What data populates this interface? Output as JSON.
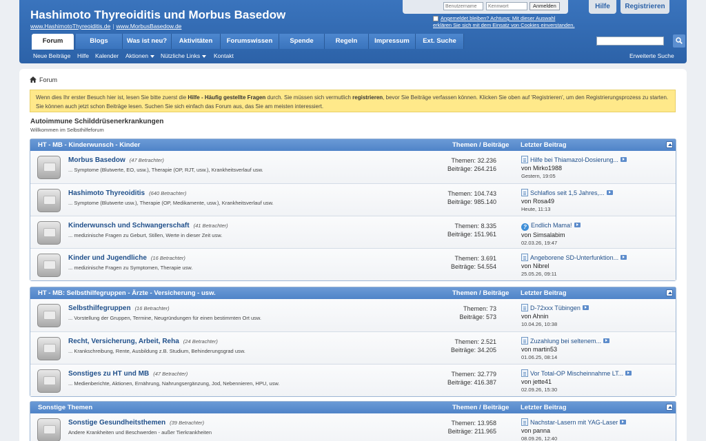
{
  "header": {
    "title": "Hashimoto Thyreoiditis und Morbus Basedow",
    "link1": "www.HashimotoThyreoiditis.de",
    "link2": "www.MorbusBasedow.de",
    "separator": "|"
  },
  "login": {
    "username_placeholder": "Benutzername",
    "password_placeholder": "Kennwort",
    "submit_label": "Anmelden",
    "remember_line1": "Angemeldet bleiben? Achtung: Mit dieser Auswahl",
    "remember_line2": "erklären Sie sich mit dem Einsatz von Cookies einverstanden."
  },
  "top_buttons": {
    "help": "Hilfe",
    "register": "Registrieren"
  },
  "nav": {
    "tabs": [
      "Forum",
      "Blogs",
      "Was ist neu?",
      "Aktivitäten",
      "Forumswissen",
      "Spende",
      "Regeln",
      "Impressum",
      "Ext. Suche"
    ],
    "search_placeholder": ""
  },
  "subnav": {
    "items": [
      "Neue Beiträge",
      "Hilfe",
      "Kalender",
      "Aktionen",
      "Nützliche Links",
      "Kontakt"
    ],
    "advanced_search": "Erweiterte Suche"
  },
  "breadcrumb": {
    "label": "Forum"
  },
  "notice": {
    "t1": "Wenn dies Ihr erster Besuch hier ist, lesen Sie bitte zuerst die ",
    "b1": "Hilfe - Häufig gestellte Fragen",
    "t2": " durch. Sie müssen sich vermutlich ",
    "b2": "registrieren",
    "t3": ", bevor Sie Beiträge verfassen können. Klicken Sie oben auf 'Registrieren', um den Registrierungsprozess zu starten. Sie können auch jetzt schon Beiträge lesen. Suchen Sie sich einfach das Forum aus, das Sie am meisten interessiert."
  },
  "category": {
    "title": "Autoimmune Schilddrüsenerkrankungen",
    "subtitle": "Willkommen im Selbsthilfeforum"
  },
  "col_stats": "Themen / Beiträge",
  "col_last": "Letzter Beitrag",
  "sections": [
    {
      "title": "HT - MB - Kinderwunsch - Kinder",
      "forums": [
        {
          "name": "Morbus Basedow",
          "viewers": "(47 Betrachter)",
          "desc": "... Symptome (Blutwerte, EO, usw.), Therapie (OP, RJT, usw.), Krankheitsverlauf usw.",
          "threads": "Themen: 32.236",
          "posts": "Beiträge: 264.216",
          "last_title": "Hilfe bei Thiamazol-Dosierung...",
          "last_by": "von Mirko1988",
          "last_date": "Gestern, 19:05",
          "icon": "doc"
        },
        {
          "name": "Hashimoto Thyreoiditis",
          "viewers": "(640 Betrachter)",
          "desc": "... Symptome (Blutwerte usw.), Therapie (OP, Medikamente, usw.), Krankheitsverlauf usw.",
          "threads": "Themen: 104.743",
          "posts": "Beiträge: 985.140",
          "last_title": "Schlaflos seit 1,5 Jahres,...",
          "last_by": "von Rosa49",
          "last_date": "Heute, 11:13",
          "icon": "doc"
        },
        {
          "name": "Kinderwunsch und Schwangerschaft",
          "viewers": "(41 Betrachter)",
          "desc": "... medizinische Fragen zu Geburt, Stillen, Werte in dieser Zeit usw.",
          "threads": "Themen: 8.335",
          "posts": "Beiträge: 151.961",
          "last_title": "Endlich Mama!",
          "last_by": "von Simsalabim",
          "last_date": "02.03.26, 19:47",
          "icon": "question"
        },
        {
          "name": "Kinder und Jugendliche",
          "viewers": "(16 Betrachter)",
          "desc": "... medizinische Fragen zu Symptomen, Therapie usw.",
          "threads": "Themen: 3.691",
          "posts": "Beiträge: 54.554",
          "last_title": "Angeborene SD-Unterfunktion...",
          "last_by": "von Nibrel",
          "last_date": "25.05.26, 09:11",
          "icon": "doc"
        }
      ]
    },
    {
      "title": "HT - MB: Selbsthilfegruppen - Ärzte - Versicherung - usw.",
      "forums": [
        {
          "name": "Selbsthilfegruppen",
          "viewers": "(16 Betrachter)",
          "desc": "... Vorstellung der Gruppen, Termine, Neugründungen für einen bestimmten Ort usw.",
          "threads": "Themen: 73",
          "posts": "Beiträge: 573",
          "last_title": "D-72xxx Tübingen",
          "last_by": "von Ahnin",
          "last_date": "10.04.26, 10:38",
          "icon": "doc"
        },
        {
          "name": "Recht, Versicherung, Arbeit, Reha",
          "viewers": "(24 Betrachter)",
          "desc": "... Krankschreibung, Rente, Ausbildung z.B. Studium, Behinderungsgrad usw.",
          "threads": "Themen: 2.521",
          "posts": "Beiträge: 34.205",
          "last_title": "Zuzahlung bei seltenem...",
          "last_by": "von martin53",
          "last_date": "01.06.25, 08:14",
          "icon": "doc"
        },
        {
          "name": "Sonstiges zu HT und MB",
          "viewers": "(47 Betrachter)",
          "desc": "... Medienberichte, Aktionen, Ernährung, Nahrungsergänzung, Jod, Nebennieren, HPU, usw.",
          "threads": "Themen: 32.779",
          "posts": "Beiträge: 416.387",
          "last_title": "Vor Total-OP Mischeinnahme LT...",
          "last_by": "von jette41",
          "last_date": "02.09.26, 15:30",
          "icon": "doc"
        }
      ]
    },
    {
      "title": "Sonstige Themen",
      "forums": [
        {
          "name": "Sonstige Gesundheitsthemen",
          "viewers": "(39 Betrachter)",
          "desc": "Andere Krankheiten und Beschwerden - außer Tierkrankheiten",
          "threads": "Themen: 13.958",
          "posts": "Beiträge: 211.965",
          "last_title": "Nachstar-Lasern mit YAG-Laser",
          "last_by": "von panna",
          "last_date": "08.09.26, 12:40",
          "icon": "doc"
        }
      ]
    }
  ],
  "colors": {
    "header_blue": "#2c62a8",
    "link_blue": "#1f4f8a",
    "notice_yellow": "#ffe98a"
  }
}
